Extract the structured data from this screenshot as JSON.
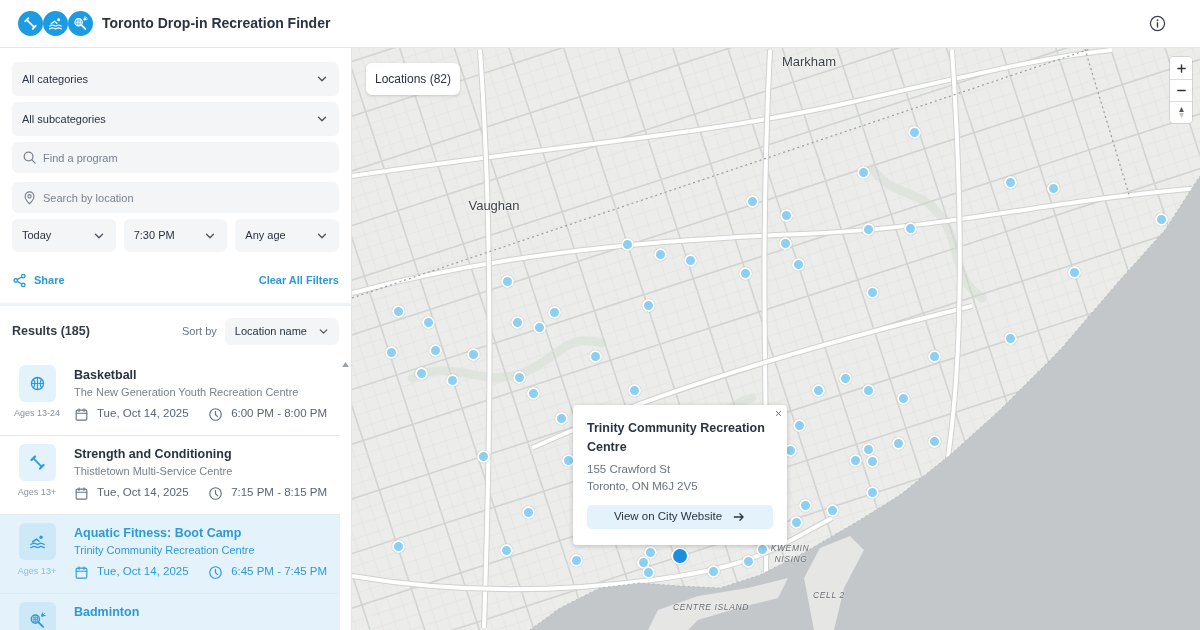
{
  "header": {
    "title": "Toronto Drop-in Recreation Finder"
  },
  "filters": {
    "category": "All categories",
    "subcategory": "All subcategories",
    "program_search": {
      "placeholder": "Find a program"
    },
    "location_search": {
      "placeholder": "Search by location"
    },
    "day": "Today",
    "time": "7:30 PM",
    "age": "Any age",
    "share": "Share",
    "clear": "Clear All Filters"
  },
  "results": {
    "title": "Results (185)",
    "sort_label": "Sort by",
    "sort_value": "Location name",
    "items": [
      {
        "kind": "basketball",
        "title": "Basketball",
        "location": "The New Generation Youth Recreation Centre",
        "ages": "Ages 13-24",
        "date": "Tue, Oct 14, 2025",
        "time": "6:00 PM - 8:00 PM",
        "selected": false
      },
      {
        "kind": "fitness",
        "title": "Strength and Conditioning",
        "location": "Thistletown Multi-Service Centre",
        "ages": "Ages 13+",
        "date": "Tue, Oct 14, 2025",
        "time": "7:15 PM - 8:15 PM",
        "selected": false
      },
      {
        "kind": "swimming",
        "title": "Aquatic Fitness: Boot Camp",
        "location": "Trinity Community Recreation Centre",
        "ages": "Ages 13+",
        "date": "Tue, Oct 14, 2025",
        "time": "6:45 PM - 7:45 PM",
        "selected": true
      },
      {
        "kind": "racquet",
        "title": "Badminton",
        "selected": true
      }
    ]
  },
  "map": {
    "locations_label": "Locations (82)",
    "place_labels": [
      {
        "text": "Markham",
        "kind": "city"
      },
      {
        "text": "Vaughan",
        "kind": "city"
      },
      {
        "text": "KWEMIN",
        "kind": "area"
      },
      {
        "text": "NISING",
        "kind": "area"
      },
      {
        "text": "CELL 2",
        "kind": "area"
      },
      {
        "text": "CENTRE ISLAND",
        "kind": "area"
      }
    ],
    "popup": {
      "title": "Trinity Community Recreation Centre",
      "address_lines": [
        "155 Crawford St",
        "Toronto, ON M6J 2V5"
      ],
      "button": "View on City Website"
    }
  }
}
